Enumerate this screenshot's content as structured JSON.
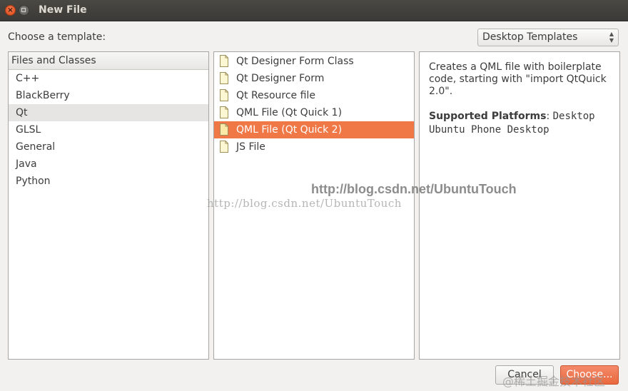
{
  "window": {
    "title": "New File"
  },
  "template_label": "Choose a template:",
  "template_dropdown": {
    "selected": "Desktop Templates"
  },
  "categories": {
    "header": "Files and Classes",
    "items": [
      "C++",
      "BlackBerry",
      "Qt",
      "GLSL",
      "General",
      "Java",
      "Python"
    ],
    "selected": "Qt"
  },
  "templates": {
    "items": [
      "Qt Designer Form Class",
      "Qt Designer Form",
      "Qt Resource file",
      "QML File (Qt Quick 1)",
      "QML File (Qt Quick 2)",
      "JS File"
    ],
    "selected": "QML File (Qt Quick 2)",
    "icon": "file-icon"
  },
  "description": {
    "text": "Creates a QML file with boilerplate code, starting with \"import QtQuick 2.0\".",
    "platforms_label": "Supported Platforms",
    "platforms_value": "Desktop Ubuntu Phone Desktop"
  },
  "watermarks": {
    "bold": "http://blog.csdn.net/UbuntuTouch",
    "light": "http://blog.csdn.net/UbuntuTouch",
    "corner": "@稀土掘金技术社区"
  },
  "buttons": {
    "cancel": "Cancel",
    "choose": "Choose..."
  },
  "colors": {
    "selection": "#f07746",
    "titlebar": "#3b3a36",
    "close": "#dd4814"
  }
}
